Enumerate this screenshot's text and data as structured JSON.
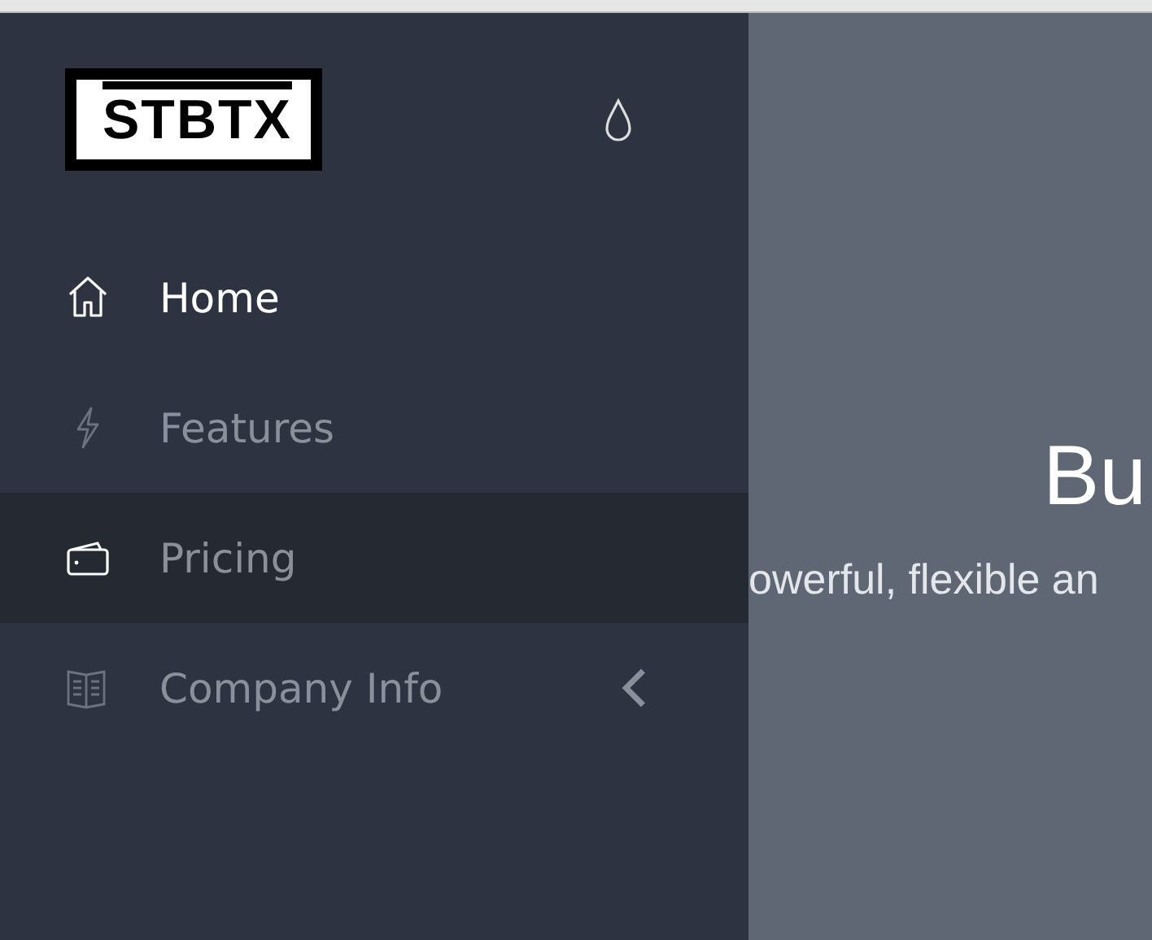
{
  "sidebar": {
    "logo": "STBTX",
    "items": [
      {
        "label": "Home",
        "kind": "home",
        "selected": true,
        "hovered": false
      },
      {
        "label": "Features",
        "kind": "bolt",
        "selected": false,
        "hovered": false
      },
      {
        "label": "Pricing",
        "kind": "wallet",
        "selected": false,
        "hovered": true
      },
      {
        "label": "Company Info",
        "kind": "book",
        "selected": false,
        "hovered": false,
        "expanded": false
      }
    ]
  },
  "hero": {
    "title": "Bu",
    "subtitle": "owerful, flexible an"
  }
}
